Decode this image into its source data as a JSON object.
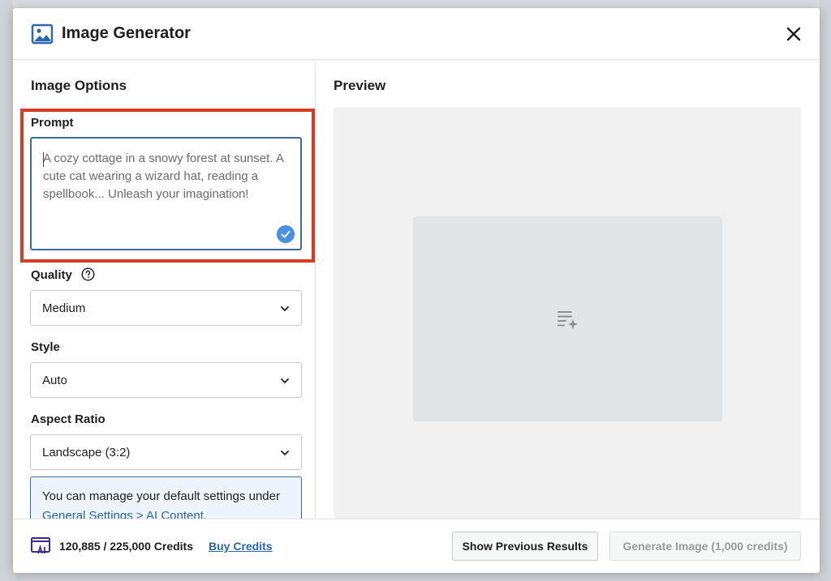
{
  "dialog": {
    "title": "Image Generator",
    "header_icon": "image-icon",
    "close_icon": "close-icon"
  },
  "options": {
    "section_title": "Image Options",
    "prompt": {
      "label": "Prompt",
      "placeholder": "A cozy cottage in a snowy forest at sunset. A cute cat wearing a wizard hat, reading a spellbook... Unleash your imagination!",
      "value": ""
    },
    "quality": {
      "label": "Quality",
      "value": "Medium",
      "help_icon": "question-circle-icon"
    },
    "style": {
      "label": "Style",
      "value": "Auto"
    },
    "aspect_ratio": {
      "label": "Aspect Ratio",
      "value": "Landscape (3:2)"
    },
    "info": {
      "text": "You can manage your default settings under ",
      "link": "General Settings > AI Content",
      "suffix": "."
    }
  },
  "preview": {
    "section_title": "Preview",
    "placeholder_icon": "sparkle-list-icon"
  },
  "footer": {
    "credits_icon": "ai-credits-icon",
    "credits": "120,885 / 225,000 Credits",
    "buy_label": "Buy Credits",
    "show_previous_label": "Show Previous Results",
    "generate_label": "Generate Image (1,000 credits)"
  },
  "colors": {
    "highlight": "#d83a22",
    "accent": "#3c6b9f",
    "link": "#2b66b1"
  }
}
